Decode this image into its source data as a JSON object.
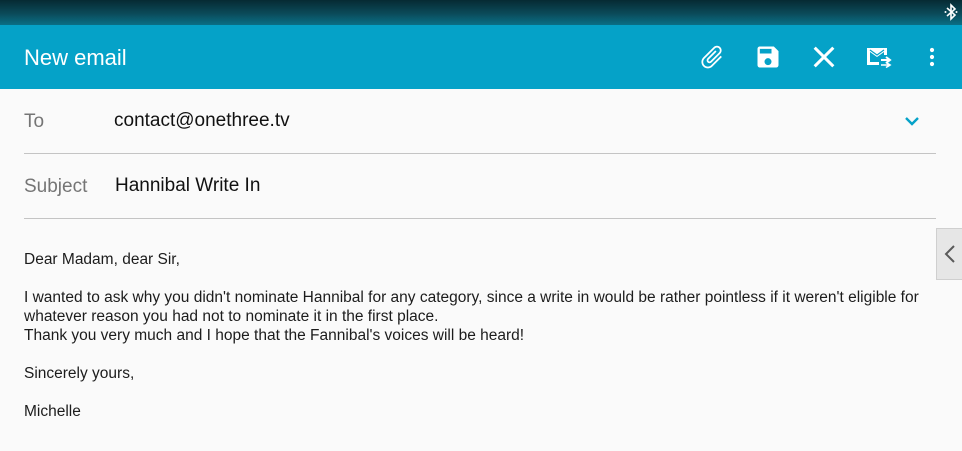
{
  "app": {
    "title": "New email"
  },
  "toolbar": {
    "icons": [
      "attach-icon",
      "save-icon",
      "close-icon",
      "send-icon",
      "more-vert-icon"
    ]
  },
  "colors": {
    "app_bar": "#05a2c8",
    "status_bar": "#0b4b5a",
    "expand_chevron": "#05a2c8"
  },
  "compose": {
    "to_label": "To",
    "to_value": "contact@onethree.tv",
    "subject_label": "Subject",
    "subject_value": "Hannibal Write In"
  },
  "message": {
    "greeting": "Dear Madam, dear Sir,",
    "line1": "I wanted to ask why you didn't nominate Hannibal for any category, since a write in would be rather pointless if it weren't eligible for whatever reason you had not to nominate it in the first place.",
    "line2": "Thank you very much and I hope that the Fannibal's voices will be heard!",
    "closing": "Sincerely yours,",
    "signature": "Michelle"
  }
}
